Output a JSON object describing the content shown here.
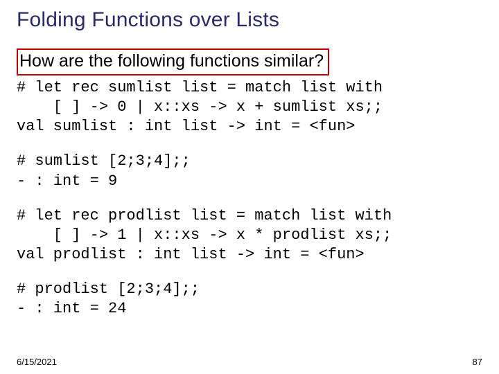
{
  "title": "Folding Functions over Lists",
  "question": "How are the following functions similar?",
  "code1": "# let rec sumlist list = match list with\n    [ ] -> 0 | x::xs -> x + sumlist xs;;\nval sumlist : int list -> int = <fun>",
  "code2": "# sumlist [2;3;4];;\n- : int = 9",
  "code3": "# let rec prodlist list = match list with\n    [ ] -> 1 | x::xs -> x * prodlist xs;;\nval prodlist : int list -> int = <fun>",
  "code4": "# prodlist [2;3;4];;\n- : int = 24",
  "footer": {
    "date": "6/15/2021",
    "page": "87"
  }
}
